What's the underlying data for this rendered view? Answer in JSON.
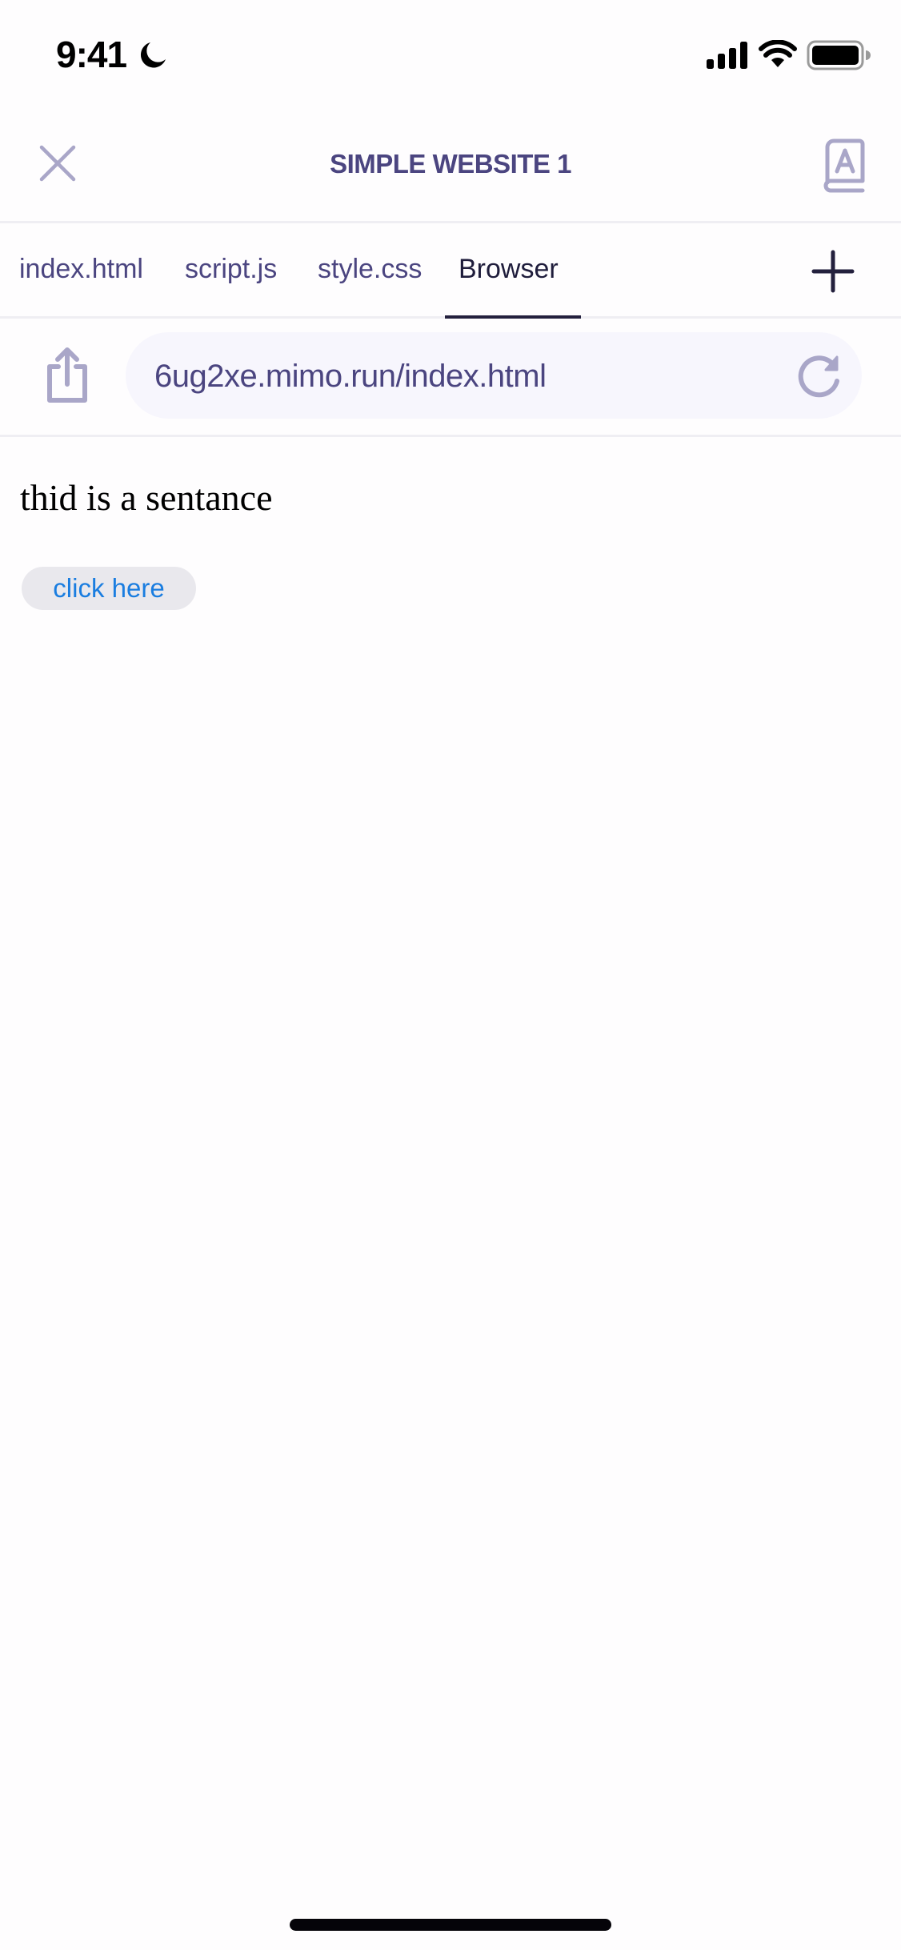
{
  "status_bar": {
    "time": "9:41",
    "focus_icon": "moon-icon",
    "signal_icon": "cellular-signal-icon",
    "wifi_icon": "wifi-icon",
    "battery_icon": "battery-icon"
  },
  "header": {
    "title": "SIMPLE WEBSITE 1",
    "close_icon": "close-icon",
    "glossary_icon": "book-icon"
  },
  "tabs": {
    "items": [
      {
        "label": "index.html",
        "active": false
      },
      {
        "label": "script.js",
        "active": false
      },
      {
        "label": "style.css",
        "active": false
      },
      {
        "label": "Browser",
        "active": true
      }
    ],
    "add_icon": "plus-icon"
  },
  "browser": {
    "share_icon": "share-icon",
    "url": "6ug2xe.mimo.run/index.html",
    "reload_icon": "reload-icon"
  },
  "page": {
    "sentence": "thid is a sentance",
    "button_label": "click here"
  },
  "colors": {
    "accent": "#4b4580",
    "icon_muted": "#a9a6c8",
    "active_tab": "#1f1d3c",
    "link_blue": "#1a7de0",
    "button_bg": "#e9e8ed",
    "url_bg": "#f7f6fd"
  }
}
